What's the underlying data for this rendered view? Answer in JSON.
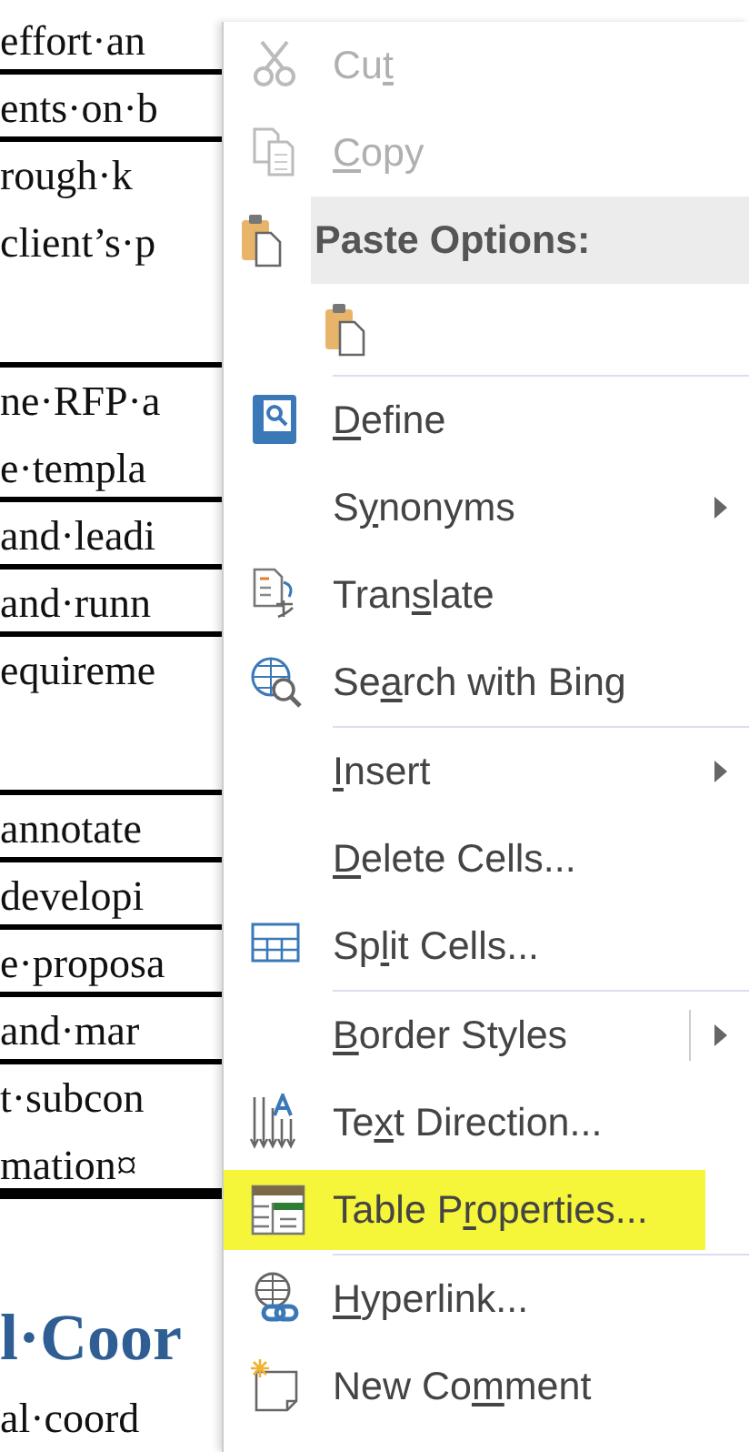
{
  "document": {
    "lines": [
      {
        "kind": "text",
        "text": "effort·an",
        "rule_below": true
      },
      {
        "kind": "text",
        "text": "ents·on·b",
        "rule_below": true
      },
      {
        "kind": "text",
        "text": "rough·k",
        "rule_below": false
      },
      {
        "kind": "text",
        "text": "client’s·p",
        "rule_below": false
      },
      {
        "kind": "blank",
        "rule_below": true
      },
      {
        "kind": "text",
        "text": "ne·RFP·a",
        "rule_below": false
      },
      {
        "kind": "text",
        "text": "e·templa",
        "rule_below": true
      },
      {
        "kind": "text",
        "text": "and·leadi",
        "rule_below": true
      },
      {
        "kind": "text",
        "text": "and·runn",
        "rule_below": true
      },
      {
        "kind": "text",
        "text": "equireme",
        "rule_below": false
      },
      {
        "kind": "blank",
        "rule_below": true
      },
      {
        "kind": "text",
        "text": "annotate",
        "rule_below": true
      },
      {
        "kind": "text",
        "text": "developi",
        "rule_below": true
      },
      {
        "kind": "text",
        "text": "e·proposa",
        "rule_below": true
      },
      {
        "kind": "text",
        "text": "and·mar",
        "rule_below": true
      },
      {
        "kind": "text",
        "text": "t·subcon",
        "rule_below": false
      },
      {
        "kind": "text",
        "text": "mation¤",
        "rule_below": true
      },
      {
        "kind": "blank",
        "rule_below": false
      },
      {
        "kind": "heading",
        "text": "l·Coor",
        "rule_below": false
      },
      {
        "kind": "text",
        "text": "al·coord",
        "rule_below": false
      }
    ]
  },
  "context_menu": {
    "items": [
      {
        "kind": "command",
        "before": "Cu",
        "access_key": "t",
        "disabled": true,
        "submenu": false,
        "highlighted": false
      },
      {
        "kind": "command",
        "access_key": "C",
        "after": "opy",
        "disabled": true,
        "submenu": false,
        "highlighted": false
      },
      {
        "kind": "header",
        "label": "Paste Options:"
      },
      {
        "kind": "paste-option"
      },
      {
        "kind": "separator"
      },
      {
        "kind": "command",
        "access_key": "D",
        "after": "efine",
        "disabled": false,
        "submenu": false,
        "highlighted": false
      },
      {
        "kind": "command",
        "before": "S",
        "access_key": "y",
        "after": "nonyms",
        "disabled": false,
        "submenu": true,
        "highlighted": false
      },
      {
        "kind": "command",
        "before": "Tran",
        "access_key": "s",
        "after": "late",
        "disabled": false,
        "submenu": false,
        "highlighted": false
      },
      {
        "kind": "command",
        "before": "Se",
        "access_key": "a",
        "after": "rch with Bing",
        "disabled": false,
        "submenu": false,
        "highlighted": false
      },
      {
        "kind": "separator"
      },
      {
        "kind": "command",
        "access_key": "I",
        "after": "nsert",
        "disabled": false,
        "submenu": true,
        "highlighted": false
      },
      {
        "kind": "command",
        "access_key": "D",
        "after": "elete Cells...",
        "disabled": false,
        "submenu": false,
        "highlighted": false
      },
      {
        "kind": "command",
        "before": "Sp",
        "access_key": "l",
        "after": "it Cells...",
        "disabled": false,
        "submenu": false,
        "highlighted": false
      },
      {
        "kind": "separator"
      },
      {
        "kind": "command",
        "access_key": "B",
        "after": "order Styles",
        "disabled": false,
        "submenu": true,
        "split": true,
        "highlighted": false
      },
      {
        "kind": "command",
        "before": "Te",
        "access_key": "x",
        "after": "t Direction...",
        "disabled": false,
        "submenu": false,
        "highlighted": false
      },
      {
        "kind": "command",
        "before": "Table P",
        "access_key": "r",
        "after": "operties...",
        "disabled": false,
        "submenu": false,
        "highlighted": true
      },
      {
        "kind": "separator"
      },
      {
        "kind": "command",
        "access_key": "H",
        "after": "yperlink...",
        "disabled": false,
        "submenu": false,
        "highlighted": false
      },
      {
        "kind": "command",
        "before": "New Co",
        "access_key": "m",
        "after": "ment",
        "disabled": false,
        "submenu": false,
        "highlighted": false
      }
    ]
  }
}
